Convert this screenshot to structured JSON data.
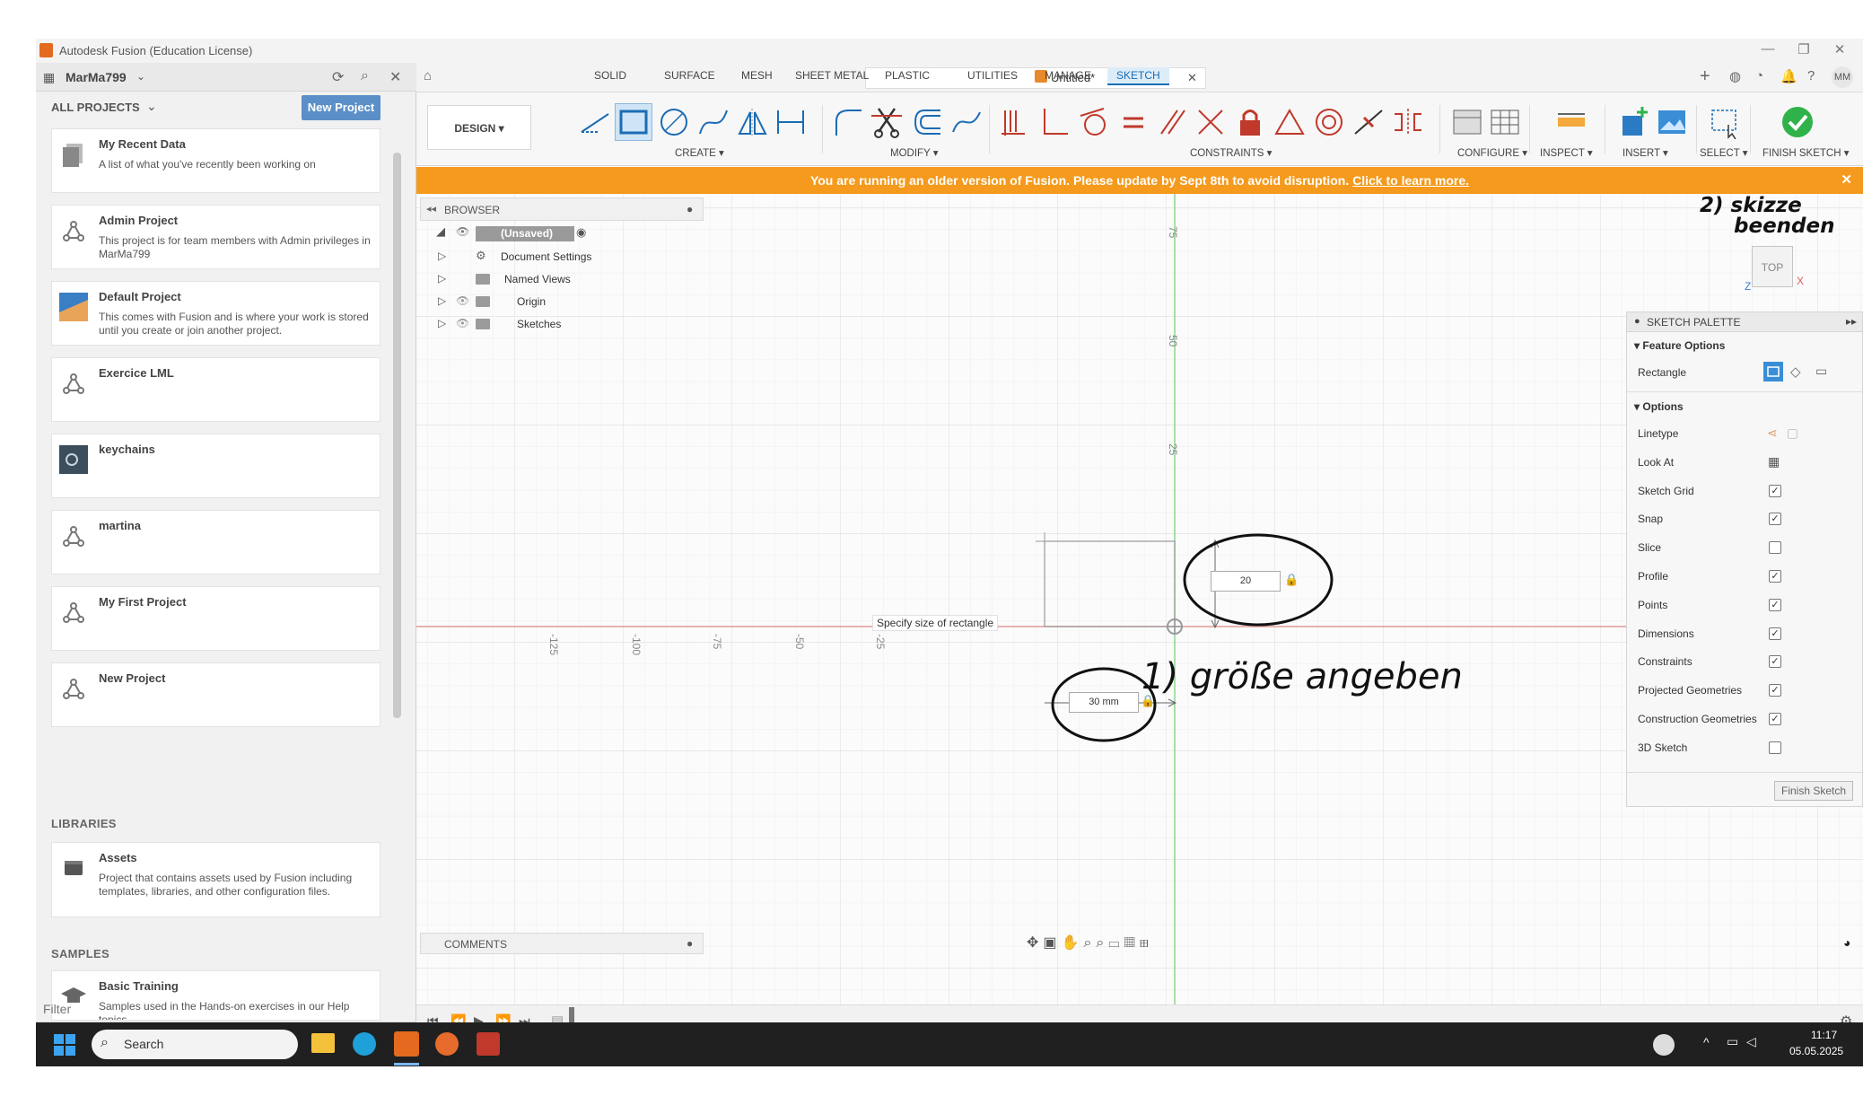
{
  "window": {
    "title": "Autodesk Fusion (Education License)",
    "minimize": "—",
    "maximize": "❐",
    "close": "✕"
  },
  "topbar": {
    "user_team": "MarMa799",
    "doc_title": "Untitled*",
    "avatar": "MM"
  },
  "projects": {
    "header": "ALL PROJECTS",
    "new_button": "New Project",
    "items": [
      {
        "name": "My Recent Data",
        "desc": "A list of what you've recently been working on",
        "icon": "recent-data-icon"
      },
      {
        "name": "Admin Project",
        "desc": "This project is for team members with Admin privileges in MarMa799",
        "icon": "project-icon"
      },
      {
        "name": "Default Project",
        "desc": "This comes with Fusion and is where your work is stored until you create or join another project.",
        "icon": "default-project-thumbnail"
      },
      {
        "name": "Exercice LML",
        "desc": "",
        "icon": "project-icon"
      },
      {
        "name": "keychains",
        "desc": "",
        "icon": "keychains-thumbnail"
      },
      {
        "name": "martina",
        "desc": "",
        "icon": "project-icon"
      },
      {
        "name": "My First Project",
        "desc": "",
        "icon": "project-icon"
      },
      {
        "name": "New Project",
        "desc": "",
        "icon": "project-icon"
      }
    ],
    "libraries_header": "LIBRARIES",
    "libraries": [
      {
        "name": "Assets",
        "desc": "Project that contains assets used by Fusion including templates, libraries, and other configuration files."
      }
    ],
    "samples_header": "SAMPLES",
    "samples": [
      {
        "name": "Basic Training",
        "desc": "Samples used in the Hands-on exercises in our Help topics."
      }
    ],
    "filter_placeholder": "Filter"
  },
  "workspace": {
    "mode": "DESIGN ▾",
    "tabs": [
      "SOLID",
      "SURFACE",
      "MESH",
      "SHEET METAL",
      "PLASTIC",
      "UTILITIES",
      "MANAGE",
      "SKETCH"
    ],
    "active_tab": "SKETCH",
    "groups": [
      "CREATE ▾",
      "MODIFY ▾",
      "CONSTRAINTS ▾",
      "CONFIGURE ▾",
      "INSPECT ▾",
      "INSERT ▾",
      "SELECT ▾",
      "FINISH SKETCH ▾"
    ]
  },
  "banner": {
    "text": "You are running an older version of Fusion. Please update by Sept 8th to avoid disruption.",
    "link": "Click to learn more."
  },
  "browser": {
    "title": "BROWSER",
    "root": "(Unsaved)",
    "nodes": [
      "Document Settings",
      "Named Views",
      "Origin",
      "Sketches"
    ]
  },
  "canvas": {
    "y_ticks": [
      "75",
      "50",
      "25"
    ],
    "x_ticks": [
      "-125",
      "-100",
      "-75",
      "-50",
      "-25"
    ],
    "tooltip": "Specify size of rectangle",
    "dim_height": "20",
    "dim_width": "30 mm",
    "viewcube_label": "TOP",
    "axis_x": "X",
    "axis_z": "Z"
  },
  "annotations": {
    "first": "1) größe angeben",
    "second_line1": "2) skizze",
    "second_line2": "beenden"
  },
  "palette": {
    "title": "SKETCH PALETTE",
    "feature_options": "Feature Options",
    "rectangle_label": "Rectangle",
    "options_header": "Options",
    "rows": [
      {
        "label": "Linetype",
        "type": "icons"
      },
      {
        "label": "Look At",
        "type": "icon"
      },
      {
        "label": "Sketch Grid",
        "checked": true
      },
      {
        "label": "Snap",
        "checked": true
      },
      {
        "label": "Slice",
        "checked": false
      },
      {
        "label": "Profile",
        "checked": true
      },
      {
        "label": "Points",
        "checked": true
      },
      {
        "label": "Dimensions",
        "checked": true
      },
      {
        "label": "Constraints",
        "checked": true
      },
      {
        "label": "Projected Geometries",
        "checked": true
      },
      {
        "label": "Construction Geometries",
        "checked": true
      },
      {
        "label": "3D Sketch",
        "checked": false
      }
    ],
    "finish_button": "Finish Sketch"
  },
  "comments": {
    "title": "COMMENTS"
  },
  "taskbar": {
    "search_placeholder": "Search",
    "time": "11:17",
    "date": "05.05.2025"
  },
  "colors": {
    "accent": "#1b6cb4",
    "banner": "#f59a1c",
    "finish_green": "#2fb24a",
    "grid_x_axis": "#e59a9a",
    "grid_y_axis": "#8fd48f"
  }
}
